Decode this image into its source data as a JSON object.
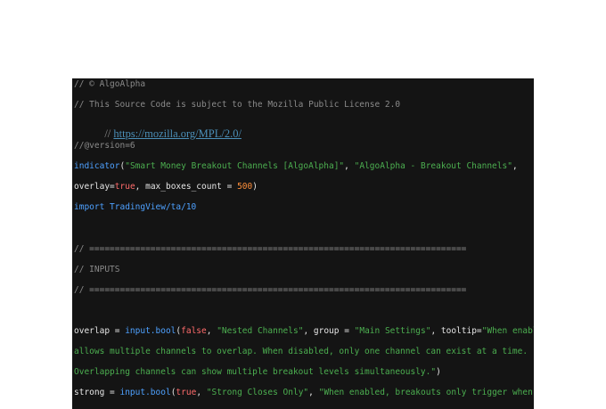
{
  "lines": {
    "l1": "// © AlgoAlpha",
    "l2": "// This Source Code is subject to the Mozilla Public License 2.0",
    "l3_prefix": "// ",
    "l3_url": "https://mozilla.org/MPL/2.0/",
    "l4": "//@version=6",
    "l5": {
      "func": "indicator",
      "p1": "(",
      "s1": "\"Smart Money Breakout Channels [AlgoAlpha]\"",
      "p2": ", ",
      "s2": "\"AlgoAlpha - Breakout Channels\"",
      "p3": ","
    },
    "l6": {
      "a": "overlay",
      "b": "=",
      "c": "true",
      "d": ", max_boxes_count = ",
      "e": "500",
      "f": ")"
    },
    "l7": {
      "kw": "import",
      "rest": " TradingView/ta/10"
    },
    "l9": "// ==========================================================================",
    "l10": "// INPUTS",
    "l11": "// ==========================================================================",
    "l13": {
      "a": "overlap = ",
      "b": "input.bool",
      "c": "(",
      "d": "false",
      "e": ", ",
      "f": "\"Nested Channels\"",
      "g": ", group = ",
      "h": "\"Main Settings\"",
      "i": ", tooltip=",
      "j": "\"When enabled,"
    },
    "l14": "allows multiple channels to overlap. When disabled, only one channel can exist at a time.",
    "l15": {
      "a": "Overlapping channels can show multiple breakout levels simultaneously.\"",
      "b": ")"
    },
    "l16": {
      "a": "strong = ",
      "b": "input.bool",
      "c": "(",
      "d": "true",
      "e": ", ",
      "f": "\"Strong Closes Only\"",
      "g": ", ",
      "h": "\"When enabled, breakouts only trigger when more"
    }
  }
}
